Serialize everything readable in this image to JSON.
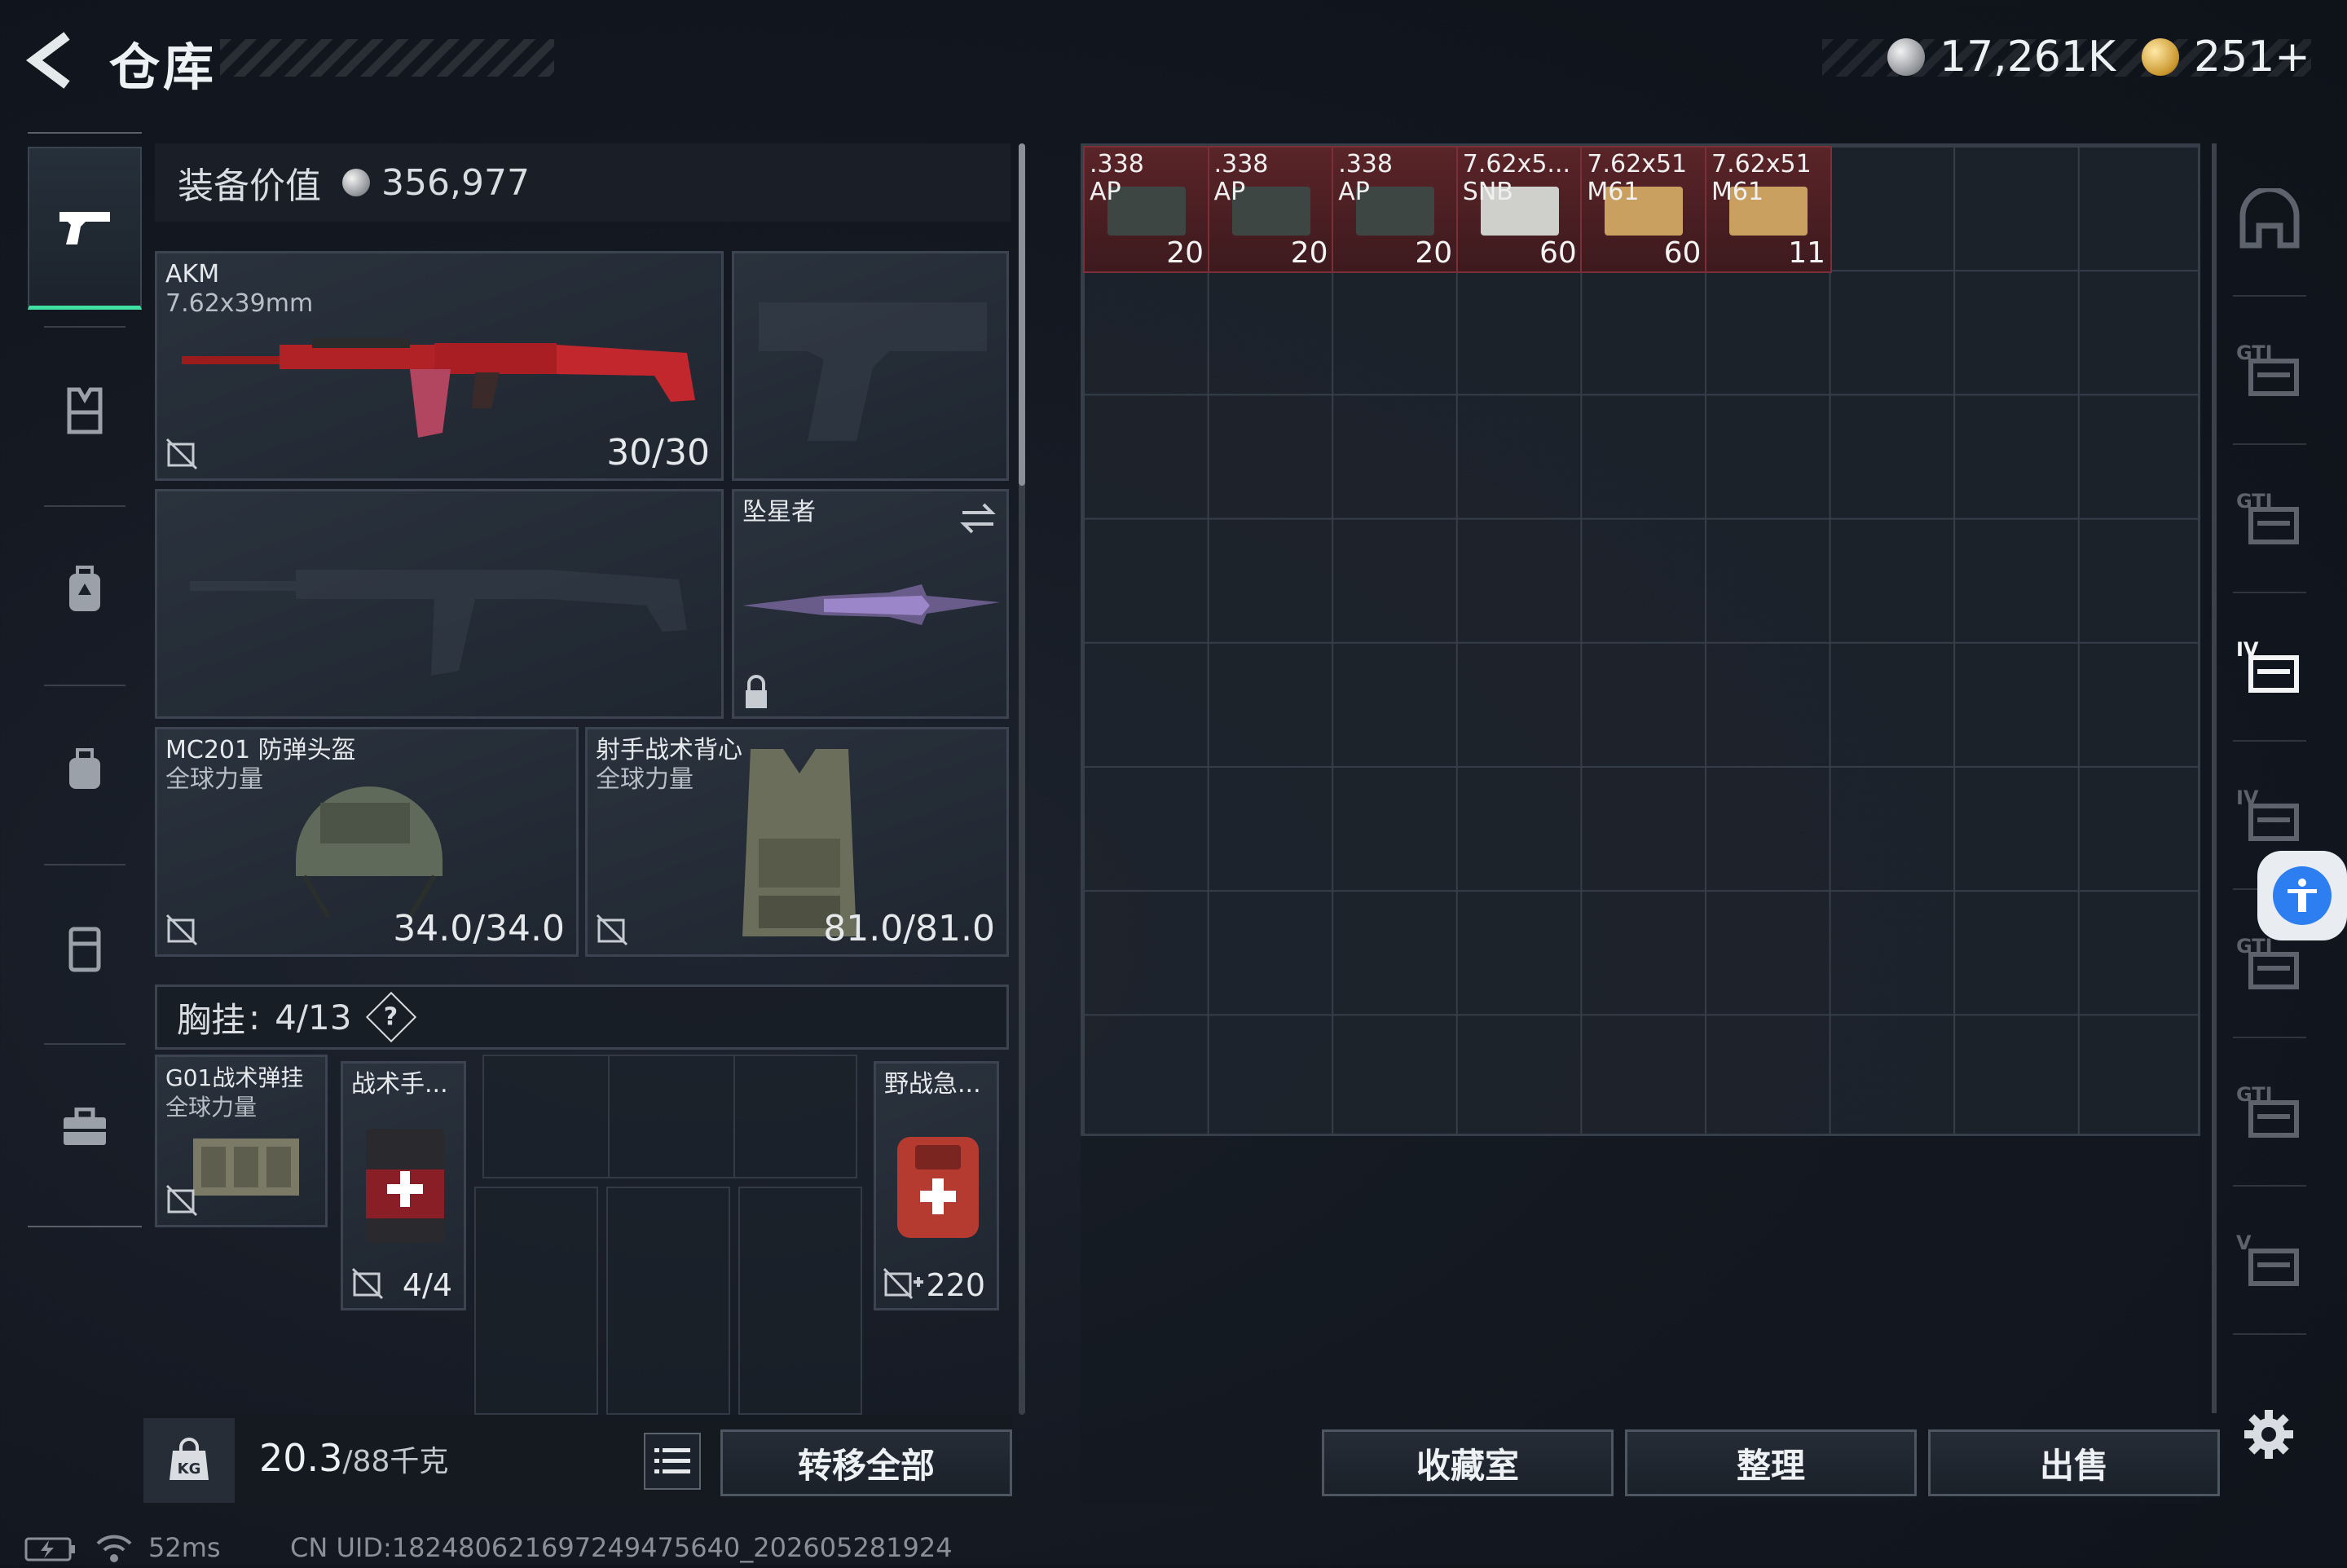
{
  "header": {
    "title": "仓库",
    "currency_silver": "17,261K",
    "currency_gold": "251+"
  },
  "equipment": {
    "value_label": "装备价值",
    "value": "356,977",
    "primary_weapon": {
      "name": "AKM",
      "caliber": "7.62x39mm",
      "ammo": "30/30"
    },
    "melee": {
      "name": "坠星者"
    },
    "helmet": {
      "name": "MC201 防弹头盔",
      "brand": "全球力量",
      "durability": "34.0/34.0"
    },
    "armor": {
      "name": "射手战术背心",
      "brand": "全球力量",
      "durability": "81.0/81.0"
    },
    "chest_rig": {
      "label": "胸挂",
      "separator": ":",
      "capacity": "4/13",
      "help": "?"
    },
    "rig_item": {
      "name": "G01战术弹挂",
      "brand": "全球力量"
    },
    "chest_items": [
      {
        "name": "战术手...",
        "count": "4/4"
      },
      {
        "name": "野战急...",
        "count": "220"
      }
    ]
  },
  "footer_left": {
    "weight": "20.3",
    "weight_max": "/88千克",
    "transfer_all": "转移全部"
  },
  "storage": {
    "items": [
      {
        "line1": ".338",
        "line2": "AP",
        "count": "20",
        "box": "#3e4644"
      },
      {
        "line1": ".338",
        "line2": "AP",
        "count": "20",
        "box": "#3e4644"
      },
      {
        "line1": ".338",
        "line2": "AP",
        "count": "20",
        "box": "#3e4644"
      },
      {
        "line1": "7.62x5...",
        "line2": "SNB",
        "count": "60",
        "box": "#cfcfcc"
      },
      {
        "line1": "7.62x51",
        "line2": "M61",
        "count": "60",
        "box": "#c9a060"
      },
      {
        "line1": "7.62x51",
        "line2": "M61",
        "count": "11",
        "box": "#c9a060"
      }
    ],
    "buttons": {
      "collection": "收藏室",
      "sort": "整理",
      "sell": "出售"
    }
  },
  "right_tabs": [
    {
      "label": "",
      "icon": "home-icon"
    },
    {
      "label": "GTI",
      "icon": "gti-container-icon"
    },
    {
      "label": "GTI",
      "icon": "gti-warning-icon"
    },
    {
      "label": "IV",
      "icon": "iv-folder-icon"
    },
    {
      "label": "IV",
      "icon": "iv-medical-icon"
    },
    {
      "label": "GTI",
      "icon": "gti-tool-icon"
    },
    {
      "label": "GTI",
      "icon": "gti-gear-icon"
    },
    {
      "label": "V",
      "icon": "v-container-icon"
    }
  ],
  "status_bar": {
    "ping": "52ms",
    "uid": "CN UID:182480621697249475640_202605281924"
  },
  "colors": {
    "accent_green": "#3fe0a2",
    "item_red": "#5a2428",
    "access_blue": "#2d7ef0"
  }
}
